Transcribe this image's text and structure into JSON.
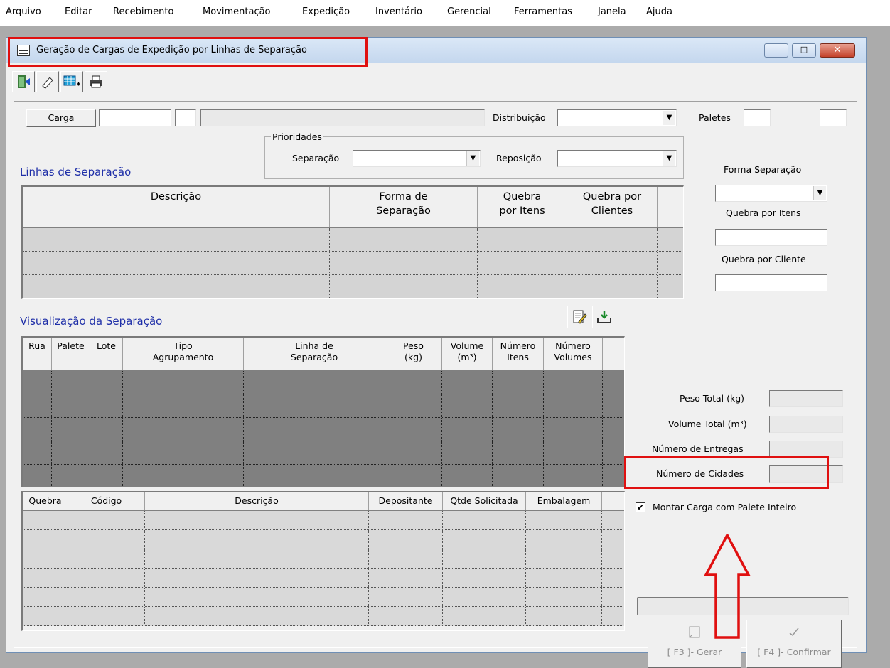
{
  "menu": [
    "Arquivo",
    "Editar",
    "Recebimento",
    "Movimentação",
    "Expedição",
    "Inventário",
    "Gerencial",
    "Ferramentas",
    "Janela",
    "Ajuda"
  ],
  "window": {
    "title": "Geração de Cargas de Expedição por Linhas de Separação",
    "minimize": "–",
    "maximize": "□",
    "close": "✕"
  },
  "toolbar": [
    {
      "icon": "exit-door-icon",
      "glyph": "🚪"
    },
    {
      "icon": "eraser-icon",
      "glyph": "✎"
    },
    {
      "icon": "add-grid-icon",
      "glyph": "▦"
    },
    {
      "icon": "printer-icon",
      "glyph": "🖶"
    }
  ],
  "form": {
    "carga_button": "Carga",
    "distribuicao_label": "Distribuição",
    "paletes_label": "Paletes",
    "prioridades_label": "Prioridades",
    "separacao_label": "Separação",
    "reposicao_label": "Reposição",
    "forma_separacao_label": "Forma Separação",
    "quebra_itens_label": "Quebra por Itens",
    "quebra_cliente_label": "Quebra por Cliente"
  },
  "linhas": {
    "title": "Linhas de Separação",
    "columns": [
      "Descrição",
      "Forma de Separação",
      "Quebra por Itens",
      "Quebra por Clientes"
    ]
  },
  "visualizacao": {
    "title": "Visualização da Separação",
    "columns": [
      "Rua",
      "Palete",
      "Lote",
      "Tipo Agrupamento",
      "Linha de Separação",
      "Peso (kg)",
      "Volume (m³)",
      "Número Itens",
      "Número Volumes"
    ]
  },
  "detalhe": {
    "columns": [
      "Quebra",
      "Código",
      "Descrição",
      "Depositante",
      "Qtde Solicitada",
      "Embalagem"
    ]
  },
  "totais": {
    "peso_label": "Peso Total (kg)",
    "volume_label": "Volume Total (m³)",
    "entregas_label": "Número de Entregas",
    "cidades_label": "Número de Cidades"
  },
  "checkbox": {
    "label": "Montar Carga com Palete Inteiro",
    "checked": true
  },
  "actions": {
    "gerar": "[ F3 ]- Gerar",
    "confirmar": "[ F4 ]- Confirmar"
  },
  "annotation_color": "#e01010"
}
